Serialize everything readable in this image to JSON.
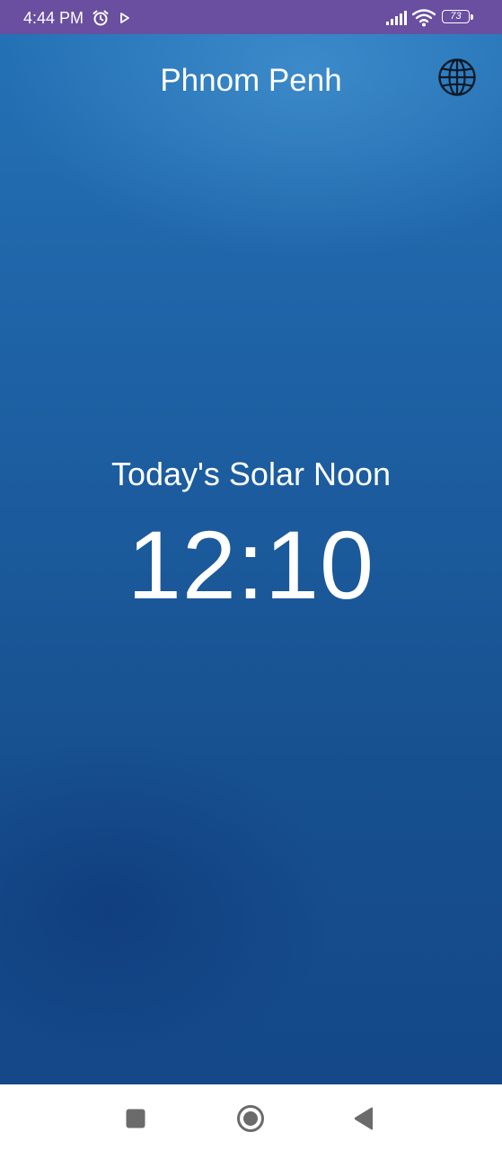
{
  "status_bar": {
    "time": "4:44 PM",
    "battery_level": "73",
    "icons": [
      "alarm-icon",
      "play-icon",
      "signal-icon",
      "wifi-icon",
      "battery-icon"
    ]
  },
  "header": {
    "city": "Phnom Penh",
    "globe_icon": "globe-icon"
  },
  "main": {
    "label": "Today's Solar Noon",
    "time": "12:10"
  },
  "nav_bar": {
    "icons": [
      "recents-square-icon",
      "home-circle-icon",
      "back-triangle-icon"
    ]
  },
  "colors": {
    "status_bar_bg": "#6a4fa0",
    "app_bg_top": "#2471b5",
    "app_bg_bottom": "#144888",
    "text": "#ffffff",
    "nav_icon": "#6b6b6b"
  }
}
